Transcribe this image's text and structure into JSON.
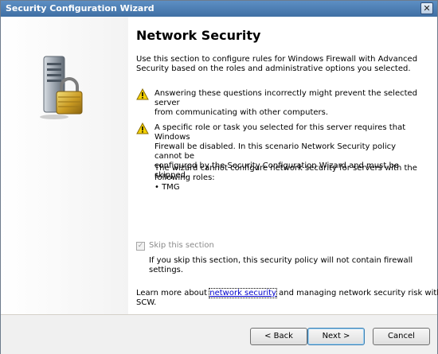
{
  "window": {
    "title": "Security Configuration Wizard",
    "close_glyph": "✕"
  },
  "content": {
    "heading": "Network Security",
    "intro_lines": [
      "Use this section to configure rules for Windows Firewall with Advanced",
      "Security based on the roles and administrative options you selected."
    ],
    "warning1_lines": [
      "Answering these questions incorrectly might prevent the selected server",
      "from communicating with other computers."
    ],
    "warning2_lines": [
      "A specific role or task you selected for this server requires that Windows",
      "Firewall be disabled. In this scenario Network Security policy cannot be",
      "configured by the Security Configuration Wizard and must be skipped."
    ],
    "roles_lines": [
      "The wizard cannot configure network security for servers with the",
      "following roles:"
    ],
    "role_item": "• TMG",
    "skip_label": "Skip this section",
    "skip_checked": true,
    "skip_desc_lines": [
      "If you skip this section, this security policy will not contain firewall",
      "settings."
    ],
    "learn_prefix": "Learn more about ",
    "learn_link": "network security",
    "learn_suffix": " and managing network security risk with",
    "learn_line2": "SCW."
  },
  "footer": {
    "back_label": "< Back",
    "next_label": "Next >",
    "cancel_label": "Cancel"
  },
  "icons": {
    "warning": "warning-icon",
    "server_lock": "server-lock-icon"
  },
  "colors": {
    "titlebar": "#4a7db5",
    "link": "#0000cc",
    "warning_yellow": "#f5d200"
  }
}
